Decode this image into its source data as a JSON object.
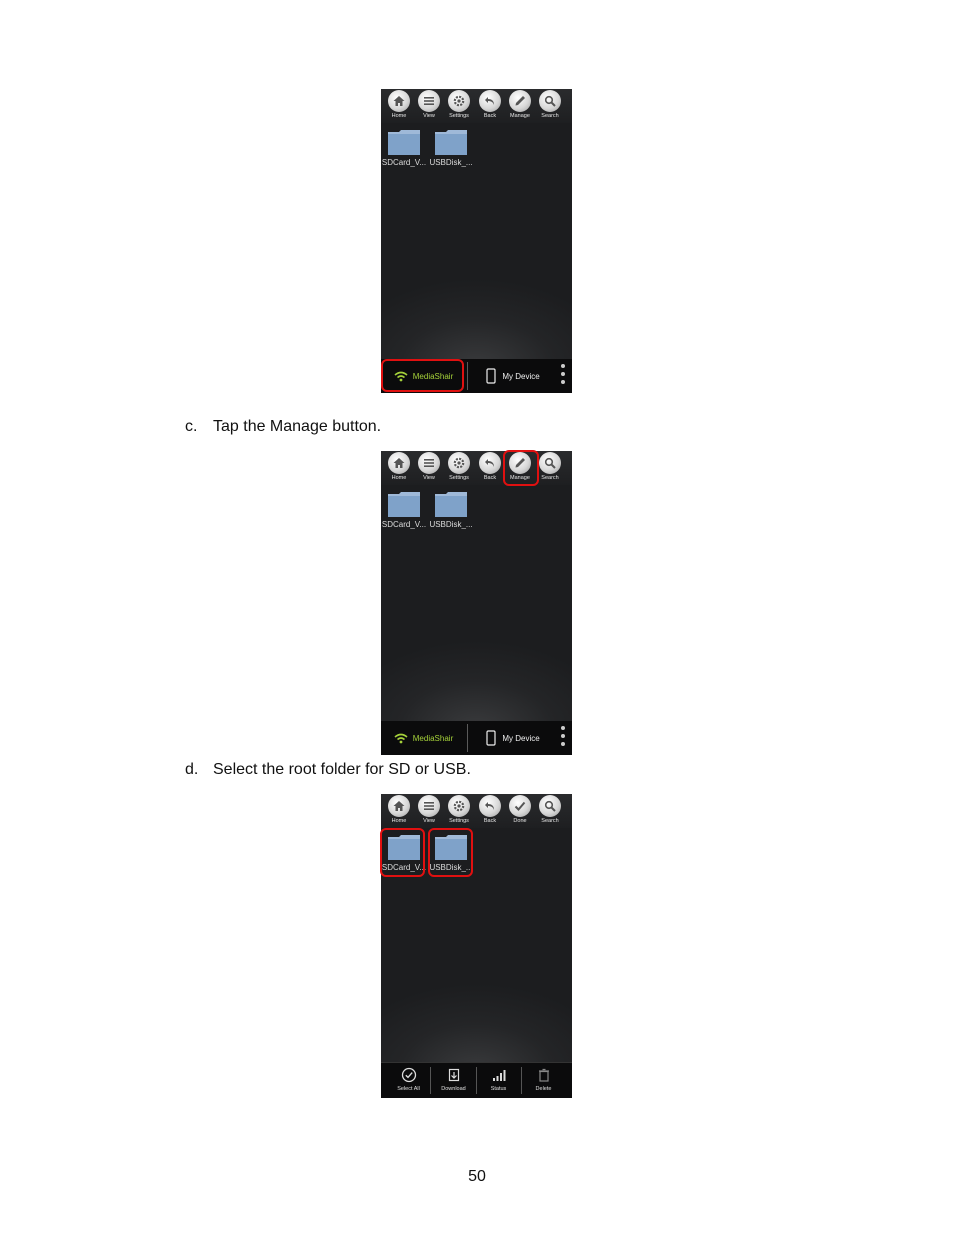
{
  "screens": [
    {
      "toolbar": [
        "Home",
        "View",
        "Settings",
        "Back",
        "Manage",
        "Search"
      ],
      "folders": [
        "SDCard_V...",
        "USBDisk_..."
      ],
      "tabs": {
        "media": "MediaShair",
        "device": "My Device"
      }
    },
    {
      "toolbar": [
        "Home",
        "View",
        "Settings",
        "Back",
        "Manage",
        "Search"
      ],
      "folders": [
        "SDCard_V...",
        "USBDisk_..."
      ],
      "tabs": {
        "media": "MediaShair",
        "device": "My Device"
      }
    },
    {
      "toolbar": [
        "Home",
        "View",
        "Settings",
        "Back",
        "Done",
        "Search"
      ],
      "folders": [
        "SDCard_V...",
        "USBDisk_..."
      ],
      "manage_bar": [
        "Select All",
        "Download",
        "Status",
        "Delete"
      ]
    }
  ],
  "steps": {
    "c": {
      "letter": "c.",
      "text": "Tap the Manage button."
    },
    "d": {
      "letter": "d.",
      "text": "Select the root folder for SD or USB."
    }
  },
  "page_number": "50",
  "colors": {
    "highlight": "#e01010",
    "mediashair_green": "#a5d13a",
    "folder_blue": "#8fb0d6"
  }
}
